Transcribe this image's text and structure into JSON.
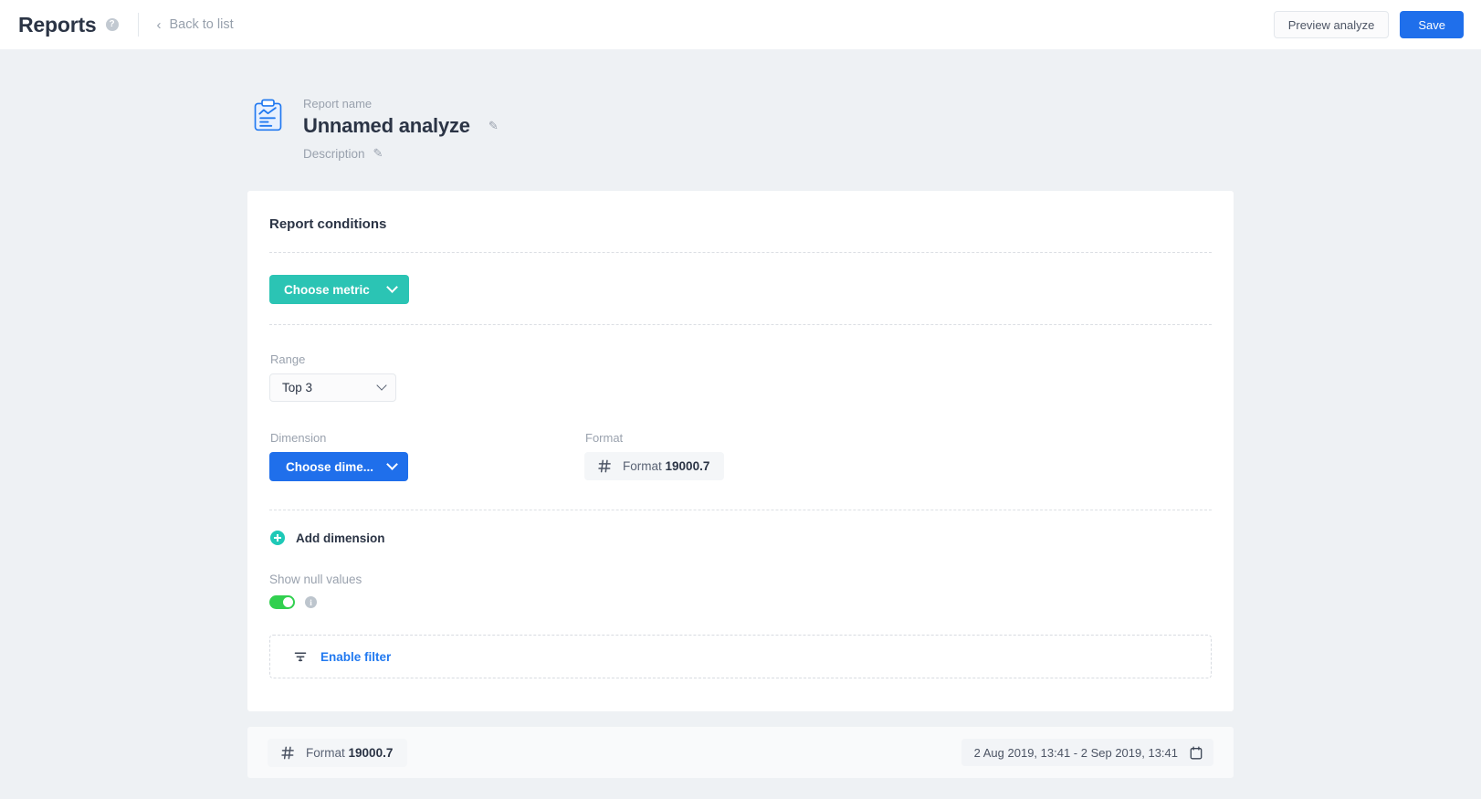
{
  "topbar": {
    "app_title": "Reports",
    "help_icon": "question-mark-icon",
    "back_label": "Back to list",
    "back_chevron": "‹",
    "preview_label": "Preview analyze",
    "save_label": "Save"
  },
  "report": {
    "icon": "clipboard-chart-icon",
    "name_label": "Report name",
    "title": "Unnamed analyze",
    "title_edit_icon": "✎",
    "description_label": "Description",
    "description_edit_icon": "✎"
  },
  "card": {
    "title": "Report conditions",
    "metric_button": {
      "label": "Choose metric",
      "color": "#2bc4b4"
    },
    "range": {
      "label": "Range",
      "value": "Top 3"
    },
    "dimension": {
      "label": "Dimension",
      "button_label": "Choose dime...",
      "color": "#1f6feb"
    },
    "format": {
      "label": "Format",
      "icon": "hash-icon",
      "prefix": "Format",
      "value": "19000.7"
    },
    "add_dimension": {
      "icon": "plus-circle-icon",
      "label": "Add dimension"
    },
    "null_values": {
      "label": "Show null values",
      "toggle_state": "on",
      "toggle_color": "#31d04f",
      "info_icon": "info-icon"
    },
    "filter": {
      "icon": "filter-icon",
      "label": "Enable filter",
      "color": "#2179f0"
    }
  },
  "bottom_bar": {
    "format": {
      "icon": "hash-icon",
      "prefix": "Format",
      "value": "19000.7"
    },
    "date_range": {
      "value": "2 Aug 2019, 13:41 - 2 Sep 2019, 13:41",
      "icon": "calendar-icon"
    }
  }
}
